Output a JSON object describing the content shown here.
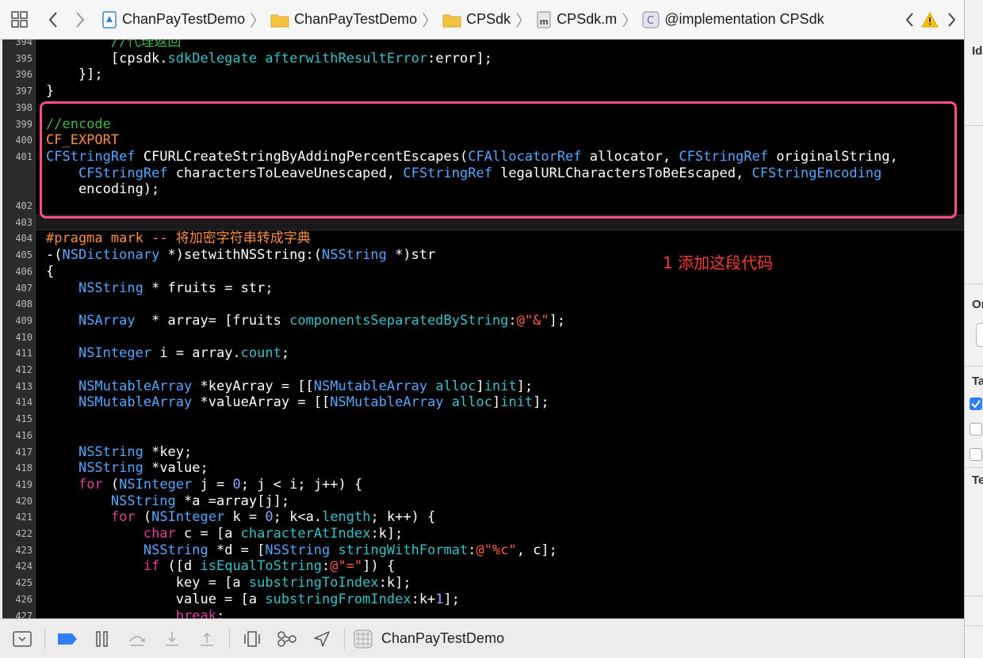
{
  "jumpbar": {
    "breadcrumbs": [
      {
        "label": "ChanPayTestDemo",
        "icon": "project-file-icon"
      },
      {
        "label": "ChanPayTestDemo",
        "icon": "folder-icon"
      },
      {
        "label": "CPSdk",
        "icon": "folder-icon"
      },
      {
        "label": "CPSdk.m",
        "icon": "objc-source-file-icon"
      },
      {
        "label": "@implementation CPSdk",
        "icon": "class-icon"
      }
    ]
  },
  "editor": {
    "highlight_line": "403",
    "lines": [
      {
        "num": "394",
        "tokens": [
          [
            "cmt",
            "        //代理返回"
          ]
        ]
      },
      {
        "num": "395",
        "tokens": [
          [
            "plain",
            "        [cpsdk."
          ],
          [
            "meth",
            "sdkDelegate"
          ],
          [
            "plain",
            " "
          ],
          [
            "meth",
            "afterwithResultError"
          ],
          [
            "plain",
            ":error];"
          ]
        ]
      },
      {
        "num": "396",
        "tokens": [
          [
            "plain",
            "    }];"
          ]
        ]
      },
      {
        "num": "397",
        "tokens": [
          [
            "plain",
            "}"
          ]
        ]
      },
      {
        "num": "398",
        "tokens": []
      },
      {
        "num": "399",
        "tokens": [
          [
            "cmt",
            "//encode"
          ]
        ]
      },
      {
        "num": "400",
        "tokens": [
          [
            "macro",
            "CF_EXPORT"
          ]
        ]
      },
      {
        "num": "401",
        "tokens": [
          [
            "type",
            "CFStringRef"
          ],
          [
            "plain",
            " CFURLCreateStringByAddingPercentEscapes("
          ],
          [
            "type",
            "CFAllocatorRef"
          ],
          [
            "plain",
            " allocator, "
          ],
          [
            "type",
            "CFStringRef"
          ],
          [
            "plain",
            " originalString,"
          ]
        ]
      },
      {
        "num": "",
        "tokens": [
          [
            "plain",
            "    "
          ],
          [
            "type",
            "CFStringRef"
          ],
          [
            "plain",
            " charactersToLeaveUnescaped, "
          ],
          [
            "type",
            "CFStringRef"
          ],
          [
            "plain",
            " legalURLCharactersToBeEscaped, "
          ],
          [
            "type",
            "CFStringEncoding"
          ]
        ]
      },
      {
        "num": "",
        "tokens": [
          [
            "plain",
            "    encoding);"
          ]
        ]
      },
      {
        "num": "402",
        "tokens": []
      },
      {
        "num": "403",
        "tokens": []
      },
      {
        "num": "404",
        "tokens": [
          [
            "macro",
            "#pragma mark -- 将加密字符串转成字典"
          ]
        ]
      },
      {
        "num": "405",
        "tokens": [
          [
            "plain",
            "-("
          ],
          [
            "type",
            "NSDictionary"
          ],
          [
            "plain",
            " *)setwithNSString:("
          ],
          [
            "type",
            "NSString"
          ],
          [
            "plain",
            " *)str"
          ]
        ]
      },
      {
        "num": "406",
        "tokens": [
          [
            "plain",
            "{"
          ]
        ]
      },
      {
        "num": "407",
        "tokens": [
          [
            "plain",
            "    "
          ],
          [
            "type",
            "NSString"
          ],
          [
            "plain",
            " * fruits = str;"
          ]
        ]
      },
      {
        "num": "408",
        "tokens": []
      },
      {
        "num": "409",
        "tokens": [
          [
            "plain",
            "    "
          ],
          [
            "type",
            "NSArray"
          ],
          [
            "plain",
            "  * array= [fruits "
          ],
          [
            "meth",
            "componentsSeparatedByString"
          ],
          [
            "plain",
            ":"
          ],
          [
            "str",
            "@\"&\""
          ],
          [
            "plain",
            "];"
          ]
        ]
      },
      {
        "num": "410",
        "tokens": []
      },
      {
        "num": "411",
        "tokens": [
          [
            "plain",
            "    "
          ],
          [
            "type",
            "NSInteger"
          ],
          [
            "plain",
            " i = array."
          ],
          [
            "prop",
            "count"
          ],
          [
            "plain",
            ";"
          ]
        ]
      },
      {
        "num": "412",
        "tokens": []
      },
      {
        "num": "413",
        "tokens": [
          [
            "plain",
            "    "
          ],
          [
            "type",
            "NSMutableArray"
          ],
          [
            "plain",
            " *keyArray = [["
          ],
          [
            "type",
            "NSMutableArray"
          ],
          [
            "plain",
            " "
          ],
          [
            "meth",
            "alloc"
          ],
          [
            "plain",
            "]"
          ],
          [
            "meth",
            "init"
          ],
          [
            "plain",
            "];"
          ]
        ]
      },
      {
        "num": "414",
        "tokens": [
          [
            "plain",
            "    "
          ],
          [
            "type",
            "NSMutableArray"
          ],
          [
            "plain",
            " *valueArray = [["
          ],
          [
            "type",
            "NSMutableArray"
          ],
          [
            "plain",
            " "
          ],
          [
            "meth",
            "alloc"
          ],
          [
            "plain",
            "]"
          ],
          [
            "meth",
            "init"
          ],
          [
            "plain",
            "];"
          ]
        ]
      },
      {
        "num": "415",
        "tokens": []
      },
      {
        "num": "416",
        "tokens": []
      },
      {
        "num": "417",
        "tokens": [
          [
            "plain",
            "    "
          ],
          [
            "type",
            "NSString"
          ],
          [
            "plain",
            " *key;"
          ]
        ]
      },
      {
        "num": "418",
        "tokens": [
          [
            "plain",
            "    "
          ],
          [
            "type",
            "NSString"
          ],
          [
            "plain",
            " *value;"
          ]
        ]
      },
      {
        "num": "419",
        "tokens": [
          [
            "plain",
            "    "
          ],
          [
            "kw",
            "for"
          ],
          [
            "plain",
            " ("
          ],
          [
            "type",
            "NSInteger"
          ],
          [
            "plain",
            " j = "
          ],
          [
            "num",
            "0"
          ],
          [
            "plain",
            "; j < i; j++) {"
          ]
        ]
      },
      {
        "num": "420",
        "tokens": [
          [
            "plain",
            "        "
          ],
          [
            "type",
            "NSString"
          ],
          [
            "plain",
            " *a =array[j];"
          ]
        ]
      },
      {
        "num": "421",
        "tokens": [
          [
            "plain",
            "        "
          ],
          [
            "kw",
            "for"
          ],
          [
            "plain",
            " ("
          ],
          [
            "type",
            "NSInteger"
          ],
          [
            "plain",
            " k = "
          ],
          [
            "num",
            "0"
          ],
          [
            "plain",
            "; k<a."
          ],
          [
            "prop",
            "length"
          ],
          [
            "plain",
            "; k++) {"
          ]
        ]
      },
      {
        "num": "422",
        "tokens": [
          [
            "plain",
            "            "
          ],
          [
            "kw",
            "char"
          ],
          [
            "plain",
            " c = [a "
          ],
          [
            "meth",
            "characterAtIndex"
          ],
          [
            "plain",
            ":k];"
          ]
        ]
      },
      {
        "num": "423",
        "tokens": [
          [
            "plain",
            "            "
          ],
          [
            "type",
            "NSString"
          ],
          [
            "plain",
            " *d = ["
          ],
          [
            "type",
            "NSString"
          ],
          [
            "plain",
            " "
          ],
          [
            "meth",
            "stringWithFormat"
          ],
          [
            "plain",
            ":"
          ],
          [
            "str",
            "@\"%c\""
          ],
          [
            "plain",
            ", c];"
          ]
        ]
      },
      {
        "num": "424",
        "tokens": [
          [
            "plain",
            "            "
          ],
          [
            "kw",
            "if"
          ],
          [
            "plain",
            " ([d "
          ],
          [
            "meth",
            "isEqualToString"
          ],
          [
            "plain",
            ":"
          ],
          [
            "str",
            "@\"=\""
          ],
          [
            "plain",
            "]) {"
          ]
        ]
      },
      {
        "num": "425",
        "tokens": [
          [
            "plain",
            "                key = [a "
          ],
          [
            "meth",
            "substringToIndex"
          ],
          [
            "plain",
            ":k];"
          ]
        ]
      },
      {
        "num": "426",
        "tokens": [
          [
            "plain",
            "                value = [a "
          ],
          [
            "meth",
            "substringFromIndex"
          ],
          [
            "plain",
            ":k+"
          ],
          [
            "num",
            "1"
          ],
          [
            "plain",
            "];"
          ]
        ]
      },
      {
        "num": "427",
        "tokens": [
          [
            "plain",
            "                "
          ],
          [
            "kw",
            "break"
          ],
          [
            "plain",
            ";"
          ]
        ]
      }
    ],
    "annotation": "1 添加这段代码"
  },
  "debugbar": {
    "scheme": "ChanPayTestDemo"
  },
  "inspector": {
    "labels": [
      "Id",
      "Or",
      "Ta",
      "Te"
    ],
    "checkboxes": [
      true,
      false,
      false
    ]
  },
  "colors": {
    "editor_bg": "#000000",
    "comment": "#41b645",
    "macro": "#fd8f3f",
    "type": "#52a8ff",
    "method": "#33c3c8",
    "keyword": "#e0419e",
    "string": "#ff5c4d",
    "annotation": "#ff3b30",
    "highlight_box": "#ff4f8b"
  }
}
